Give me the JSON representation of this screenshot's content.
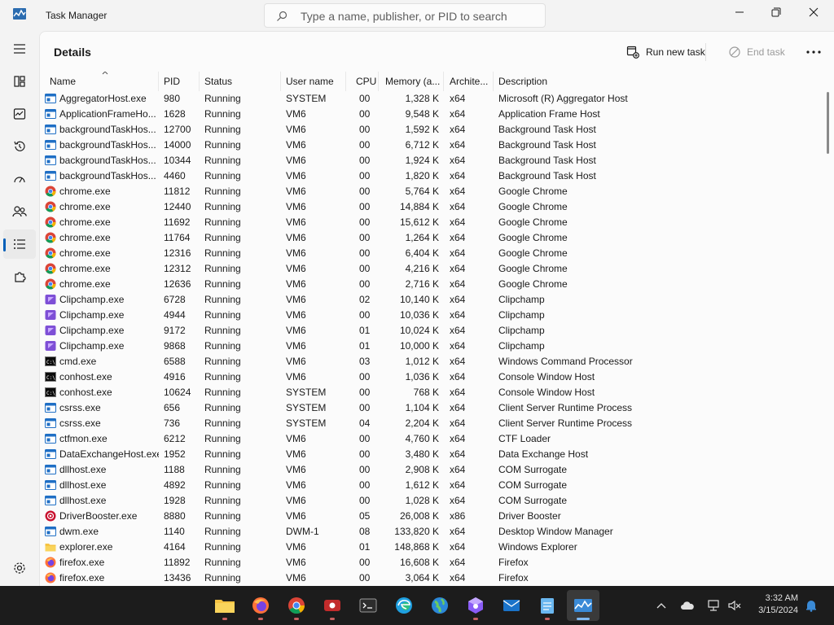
{
  "window": {
    "title": "Task Manager",
    "search_placeholder": "Type a name, publisher, or PID to search"
  },
  "page": {
    "title": "Details",
    "run_new_task": "Run new task",
    "end_task": "End task"
  },
  "table": {
    "columns": [
      "Name",
      "PID",
      "Status",
      "User name",
      "CPU",
      "Memory (a...",
      "Archite...",
      "Description"
    ],
    "rows": [
      {
        "icon": "app-window-icon",
        "name": "AggregatorHost.exe",
        "pid": "980",
        "status": "Running",
        "user": "SYSTEM",
        "cpu": "00",
        "memory": "1,328 K",
        "arch": "x64",
        "desc": "Microsoft (R) Aggregator Host"
      },
      {
        "icon": "app-window-icon",
        "name": "ApplicationFrameHo...",
        "pid": "1628",
        "status": "Running",
        "user": "VM6",
        "cpu": "00",
        "memory": "9,548 K",
        "arch": "x64",
        "desc": "Application Frame Host"
      },
      {
        "icon": "app-window-icon",
        "name": "backgroundTaskHos...",
        "pid": "12700",
        "status": "Running",
        "user": "VM6",
        "cpu": "00",
        "memory": "1,592 K",
        "arch": "x64",
        "desc": "Background Task Host"
      },
      {
        "icon": "app-window-icon",
        "name": "backgroundTaskHos...",
        "pid": "14000",
        "status": "Running",
        "user": "VM6",
        "cpu": "00",
        "memory": "6,712 K",
        "arch": "x64",
        "desc": "Background Task Host"
      },
      {
        "icon": "app-window-icon",
        "name": "backgroundTaskHos...",
        "pid": "10344",
        "status": "Running",
        "user": "VM6",
        "cpu": "00",
        "memory": "1,924 K",
        "arch": "x64",
        "desc": "Background Task Host"
      },
      {
        "icon": "app-window-icon",
        "name": "backgroundTaskHos...",
        "pid": "4460",
        "status": "Running",
        "user": "VM6",
        "cpu": "00",
        "memory": "1,820 K",
        "arch": "x64",
        "desc": "Background Task Host"
      },
      {
        "icon": "chrome-icon",
        "name": "chrome.exe",
        "pid": "11812",
        "status": "Running",
        "user": "VM6",
        "cpu": "00",
        "memory": "5,764 K",
        "arch": "x64",
        "desc": "Google Chrome"
      },
      {
        "icon": "chrome-icon",
        "name": "chrome.exe",
        "pid": "12440",
        "status": "Running",
        "user": "VM6",
        "cpu": "00",
        "memory": "14,884 K",
        "arch": "x64",
        "desc": "Google Chrome"
      },
      {
        "icon": "chrome-icon",
        "name": "chrome.exe",
        "pid": "11692",
        "status": "Running",
        "user": "VM6",
        "cpu": "00",
        "memory": "15,612 K",
        "arch": "x64",
        "desc": "Google Chrome"
      },
      {
        "icon": "chrome-icon",
        "name": "chrome.exe",
        "pid": "11764",
        "status": "Running",
        "user": "VM6",
        "cpu": "00",
        "memory": "1,264 K",
        "arch": "x64",
        "desc": "Google Chrome"
      },
      {
        "icon": "chrome-icon",
        "name": "chrome.exe",
        "pid": "12316",
        "status": "Running",
        "user": "VM6",
        "cpu": "00",
        "memory": "6,404 K",
        "arch": "x64",
        "desc": "Google Chrome"
      },
      {
        "icon": "chrome-icon",
        "name": "chrome.exe",
        "pid": "12312",
        "status": "Running",
        "user": "VM6",
        "cpu": "00",
        "memory": "4,216 K",
        "arch": "x64",
        "desc": "Google Chrome"
      },
      {
        "icon": "chrome-icon",
        "name": "chrome.exe",
        "pid": "12636",
        "status": "Running",
        "user": "VM6",
        "cpu": "00",
        "memory": "2,716 K",
        "arch": "x64",
        "desc": "Google Chrome"
      },
      {
        "icon": "clipchamp-icon",
        "name": "Clipchamp.exe",
        "pid": "6728",
        "status": "Running",
        "user": "VM6",
        "cpu": "02",
        "memory": "10,140 K",
        "arch": "x64",
        "desc": "Clipchamp"
      },
      {
        "icon": "clipchamp-icon",
        "name": "Clipchamp.exe",
        "pid": "4944",
        "status": "Running",
        "user": "VM6",
        "cpu": "00",
        "memory": "10,036 K",
        "arch": "x64",
        "desc": "Clipchamp"
      },
      {
        "icon": "clipchamp-icon",
        "name": "Clipchamp.exe",
        "pid": "9172",
        "status": "Running",
        "user": "VM6",
        "cpu": "01",
        "memory": "10,024 K",
        "arch": "x64",
        "desc": "Clipchamp"
      },
      {
        "icon": "clipchamp-icon",
        "name": "Clipchamp.exe",
        "pid": "9868",
        "status": "Running",
        "user": "VM6",
        "cpu": "01",
        "memory": "10,000 K",
        "arch": "x64",
        "desc": "Clipchamp"
      },
      {
        "icon": "console-icon",
        "name": "cmd.exe",
        "pid": "6588",
        "status": "Running",
        "user": "VM6",
        "cpu": "03",
        "memory": "1,012 K",
        "arch": "x64",
        "desc": "Windows Command Processor"
      },
      {
        "icon": "console-icon",
        "name": "conhost.exe",
        "pid": "4916",
        "status": "Running",
        "user": "VM6",
        "cpu": "00",
        "memory": "1,036 K",
        "arch": "x64",
        "desc": "Console Window Host"
      },
      {
        "icon": "console-icon",
        "name": "conhost.exe",
        "pid": "10624",
        "status": "Running",
        "user": "SYSTEM",
        "cpu": "00",
        "memory": "768 K",
        "arch": "x64",
        "desc": "Console Window Host"
      },
      {
        "icon": "app-window-icon",
        "name": "csrss.exe",
        "pid": "656",
        "status": "Running",
        "user": "SYSTEM",
        "cpu": "00",
        "memory": "1,104 K",
        "arch": "x64",
        "desc": "Client Server Runtime Process"
      },
      {
        "icon": "app-window-icon",
        "name": "csrss.exe",
        "pid": "736",
        "status": "Running",
        "user": "SYSTEM",
        "cpu": "04",
        "memory": "2,204 K",
        "arch": "x64",
        "desc": "Client Server Runtime Process"
      },
      {
        "icon": "app-window-icon",
        "name": "ctfmon.exe",
        "pid": "6212",
        "status": "Running",
        "user": "VM6",
        "cpu": "00",
        "memory": "4,760 K",
        "arch": "x64",
        "desc": "CTF Loader"
      },
      {
        "icon": "app-window-icon",
        "name": "DataExchangeHost.exe",
        "pid": "1952",
        "status": "Running",
        "user": "VM6",
        "cpu": "00",
        "memory": "3,480 K",
        "arch": "x64",
        "desc": "Data Exchange Host"
      },
      {
        "icon": "app-window-icon",
        "name": "dllhost.exe",
        "pid": "1188",
        "status": "Running",
        "user": "VM6",
        "cpu": "00",
        "memory": "2,908 K",
        "arch": "x64",
        "desc": "COM Surrogate"
      },
      {
        "icon": "app-window-icon",
        "name": "dllhost.exe",
        "pid": "4892",
        "status": "Running",
        "user": "VM6",
        "cpu": "00",
        "memory": "1,612 K",
        "arch": "x64",
        "desc": "COM Surrogate"
      },
      {
        "icon": "app-window-icon",
        "name": "dllhost.exe",
        "pid": "1928",
        "status": "Running",
        "user": "VM6",
        "cpu": "00",
        "memory": "1,028 K",
        "arch": "x64",
        "desc": "COM Surrogate"
      },
      {
        "icon": "driver-booster-icon",
        "name": "DriverBooster.exe",
        "pid": "8880",
        "status": "Running",
        "user": "VM6",
        "cpu": "05",
        "memory": "26,008 K",
        "arch": "x86",
        "desc": "Driver Booster"
      },
      {
        "icon": "app-window-icon",
        "name": "dwm.exe",
        "pid": "1140",
        "status": "Running",
        "user": "DWM-1",
        "cpu": "08",
        "memory": "133,820 K",
        "arch": "x64",
        "desc": "Desktop Window Manager"
      },
      {
        "icon": "folder-icon",
        "name": "explorer.exe",
        "pid": "4164",
        "status": "Running",
        "user": "VM6",
        "cpu": "01",
        "memory": "148,868 K",
        "arch": "x64",
        "desc": "Windows Explorer"
      },
      {
        "icon": "firefox-icon",
        "name": "firefox.exe",
        "pid": "11892",
        "status": "Running",
        "user": "VM6",
        "cpu": "00",
        "memory": "16,608 K",
        "arch": "x64",
        "desc": "Firefox"
      },
      {
        "icon": "firefox-icon",
        "name": "firefox.exe",
        "pid": "13436",
        "status": "Running",
        "user": "VM6",
        "cpu": "00",
        "memory": "3,064 K",
        "arch": "x64",
        "desc": "Firefox"
      }
    ]
  },
  "taskbar": {
    "time": "3:32 AM",
    "date": "3/15/2024"
  },
  "colors": {
    "accent": "#005fb8",
    "chrome_red": "#db4437",
    "chrome_green": "#0f9d58",
    "chrome_yellow": "#f4b400",
    "chrome_blue": "#4285f4"
  }
}
